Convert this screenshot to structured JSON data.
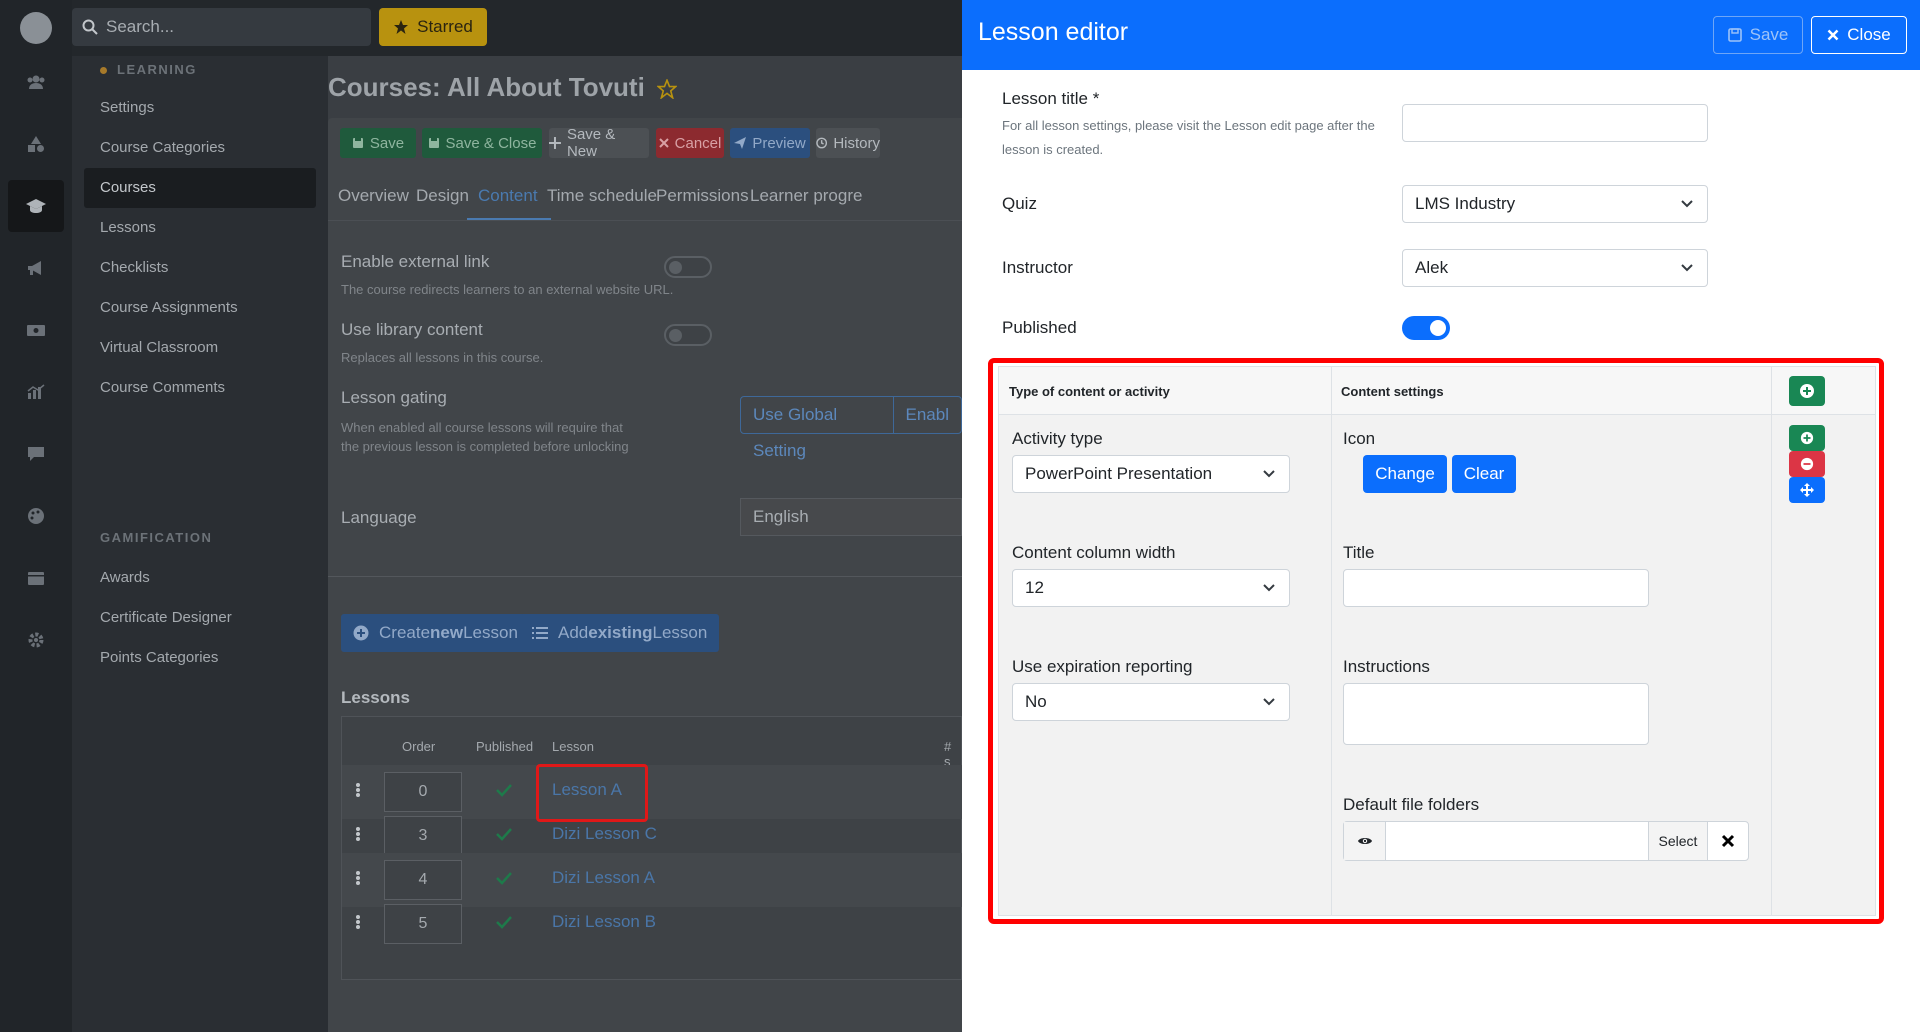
{
  "topbar": {
    "search_placeholder": "Search...",
    "starred_label": "Starred"
  },
  "sidebar": {
    "learning_heading": "LEARNING",
    "learning_items": [
      {
        "label": "Settings"
      },
      {
        "label": "Course Categories"
      },
      {
        "label": "Courses"
      },
      {
        "label": "Lessons"
      },
      {
        "label": "Checklists"
      },
      {
        "label": "Course Assignments"
      },
      {
        "label": "Virtual Classroom"
      },
      {
        "label": "Course Comments"
      }
    ],
    "gamification_heading": "GAMIFICATION",
    "gamification_items": [
      {
        "label": "Awards"
      },
      {
        "label": "Certificate Designer"
      },
      {
        "label": "Points Categories"
      }
    ]
  },
  "page": {
    "title": "Courses: All About Tovuti",
    "toolbar": {
      "save": "Save",
      "save_close": "Save & Close",
      "save_new": "Save & New",
      "cancel": "Cancel",
      "preview": "Preview",
      "history": "History"
    },
    "tabs": [
      {
        "label": "Overview"
      },
      {
        "label": "Design"
      },
      {
        "label": "Content"
      },
      {
        "label": "Time schedule"
      },
      {
        "label": "Permissions"
      },
      {
        "label": "Learner progre"
      }
    ],
    "external_link": {
      "label": "Enable external link",
      "help": "The course redirects learners to an external website URL."
    },
    "library": {
      "label": "Use library content",
      "help": "Replaces all lessons in this course."
    },
    "gating": {
      "label": "Lesson gating",
      "help": "When enabled all course lessons will require that the previous lesson is completed before unlocking",
      "opt1": "Use Global Setting",
      "opt2": "Enabl"
    },
    "language": {
      "label": "Language",
      "value": "English"
    },
    "create_lesson": {
      "pre": "Create ",
      "bold": "new",
      "post": " Lesson"
    },
    "add_lesson": {
      "pre": "Add ",
      "bold": "existing",
      "post": " Lesson"
    },
    "lessons_heading": "Lessons",
    "lessons_table": {
      "col_order": "Order",
      "col_published": "Published",
      "col_lesson": "Lesson",
      "col_extra": "# s",
      "rows": [
        {
          "order": "0",
          "name": "Lesson A"
        },
        {
          "order": "3",
          "name": "Dizi Lesson C"
        },
        {
          "order": "4",
          "name": "Dizi Lesson A"
        },
        {
          "order": "5",
          "name": "Dizi Lesson B"
        }
      ]
    }
  },
  "editor": {
    "title": "Lesson editor",
    "save": "Save",
    "close": "Close",
    "lesson_title_label": "Lesson title *",
    "lesson_title_help": "For all lesson settings, please visit the Lesson edit page after the lesson is created.",
    "quiz_label": "Quiz",
    "quiz_value": "LMS Industry",
    "instructor_label": "Instructor",
    "instructor_value": "Alek",
    "published_label": "Published",
    "table": {
      "col_type": "Type of content or activity",
      "col_settings": "Content settings",
      "activity_type_label": "Activity type",
      "activity_type_value": "PowerPoint Presentation",
      "column_width_label": "Content column width",
      "column_width_value": "12",
      "expiration_label": "Use expiration reporting",
      "expiration_value": "No",
      "icon_label": "Icon",
      "change": "Change",
      "clear": "Clear",
      "title_label": "Title",
      "instructions_label": "Instructions",
      "folders_label": "Default file folders",
      "select": "Select"
    }
  },
  "colors": {
    "accent": "#0b6efd",
    "success": "#198754",
    "danger": "#dc3545",
    "highlight": "#ff0000",
    "starred": "#b8920f"
  }
}
